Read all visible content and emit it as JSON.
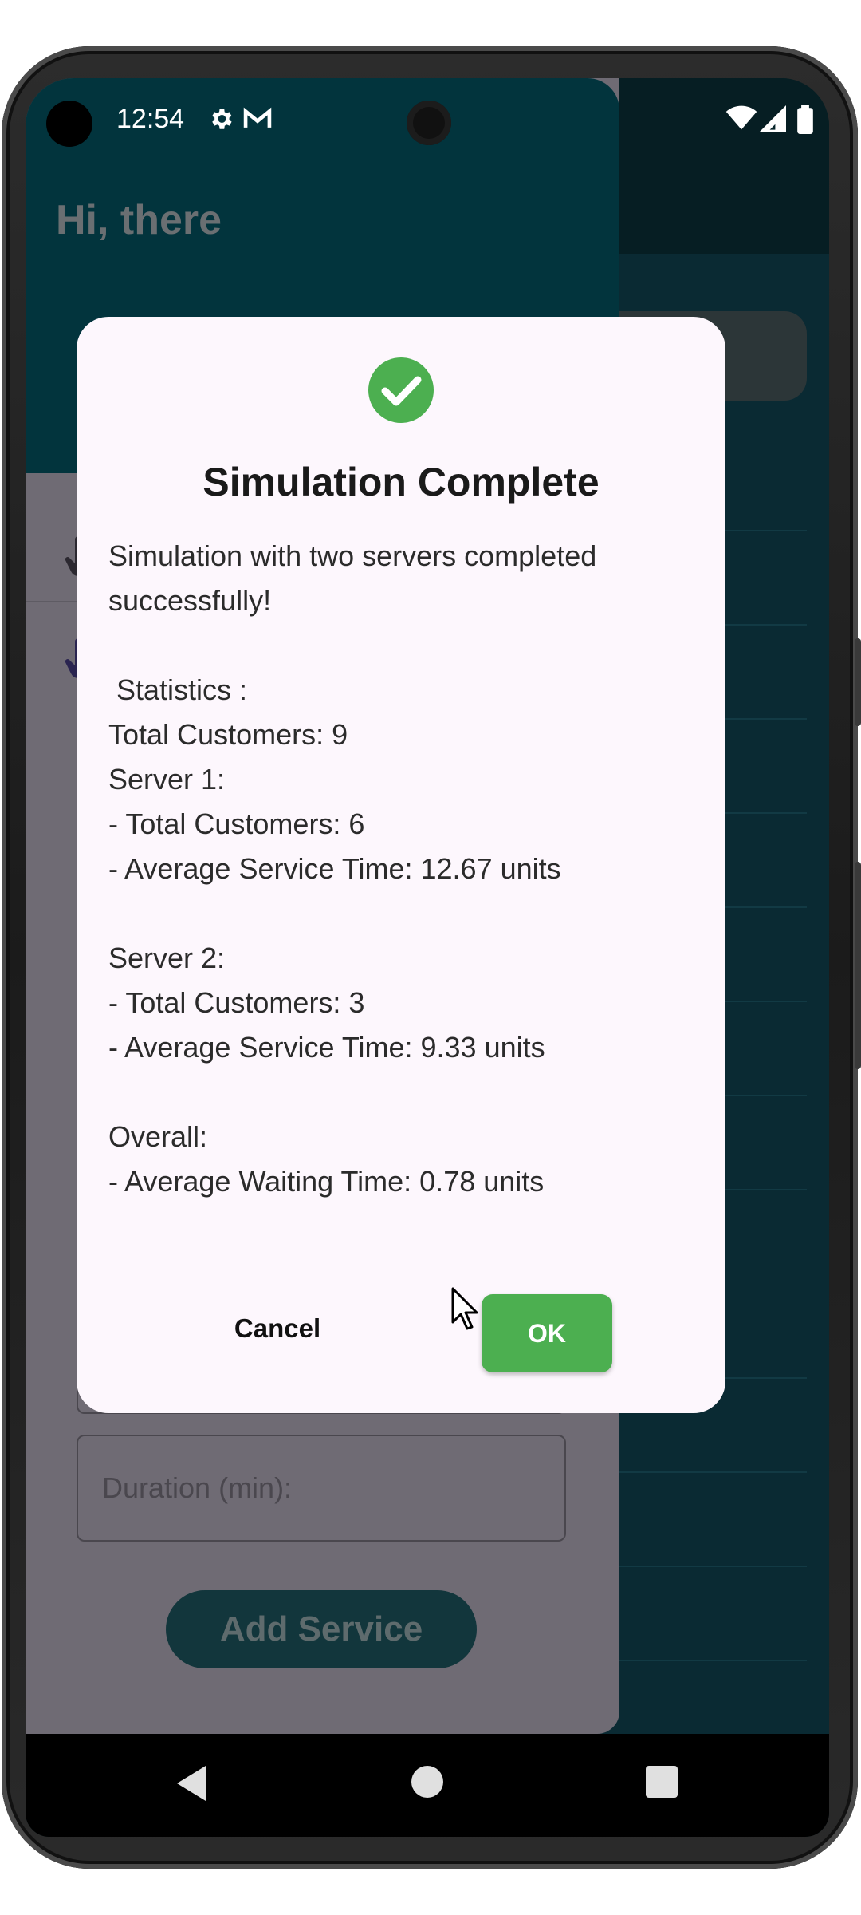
{
  "status_bar": {
    "time": "12:54",
    "icons": [
      "gear-icon",
      "gmail-icon",
      "wifi-icon",
      "signal-icon",
      "battery-icon"
    ]
  },
  "drawer": {
    "greeting": "Hi, there",
    "field_label": "Duration (min):",
    "add_service_label": "Add Service"
  },
  "dialog": {
    "icon": "check-circle-icon",
    "title": "Simulation Complete",
    "lines": [
      "Simulation with two servers completed",
      "successfully!",
      "",
      " Statistics :",
      "Total Customers: 9",
      "Server 1:",
      "- Total Customers: 6",
      "- Average Service Time: 12.67 units",
      "",
      "Server 2:",
      "- Total Customers: 3",
      "- Average Service Time: 9.33 units",
      "",
      "Overall:",
      "- Average Waiting Time: 0.78 units"
    ],
    "cancel_label": "Cancel",
    "ok_label": "OK"
  },
  "colors": {
    "accent": "#4caf50",
    "dialog_bg": "#fdf7fd",
    "header_bg": "#02343d"
  }
}
